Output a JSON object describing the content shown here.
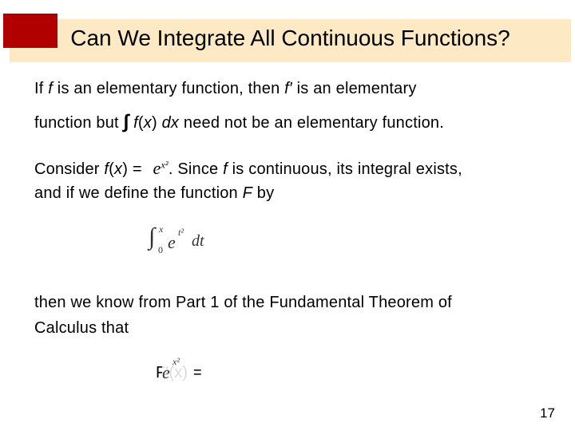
{
  "slide": {
    "title": "Can We Integrate All Continuous Functions?",
    "page_number": "17",
    "p1": {
      "a": "If ",
      "f": "f",
      "b": " is an elementary function, then ",
      "fp": "f′",
      "c": " is an elementary"
    },
    "p2": {
      "a": "function but ",
      "int": "∫",
      "fx": "f",
      "x": "(x) ",
      "dx": "dx",
      "b": " need not be an elementary function."
    },
    "p3": {
      "a": "Consider ",
      "fx": "f",
      "x": "(x) = ",
      "formula": "e",
      "exp": "x²",
      "b": ". Since ",
      "f": "f",
      "c": " is continuous, its integral exists,"
    },
    "p4": {
      "a": "and if we define the function ",
      "F": "F",
      "b": " by"
    },
    "integral": {
      "sym": "∫",
      "upper": "x",
      "lower": "0",
      "base": "e",
      "exp": "t²",
      "dt": "dt"
    },
    "p5": "then we know from Part 1 of the Fundamental Theorem of",
    "p6": "Calculus that",
    "derivative": {
      "lhs": "F′(x) =",
      "base": "e",
      "exp": "x²"
    }
  }
}
